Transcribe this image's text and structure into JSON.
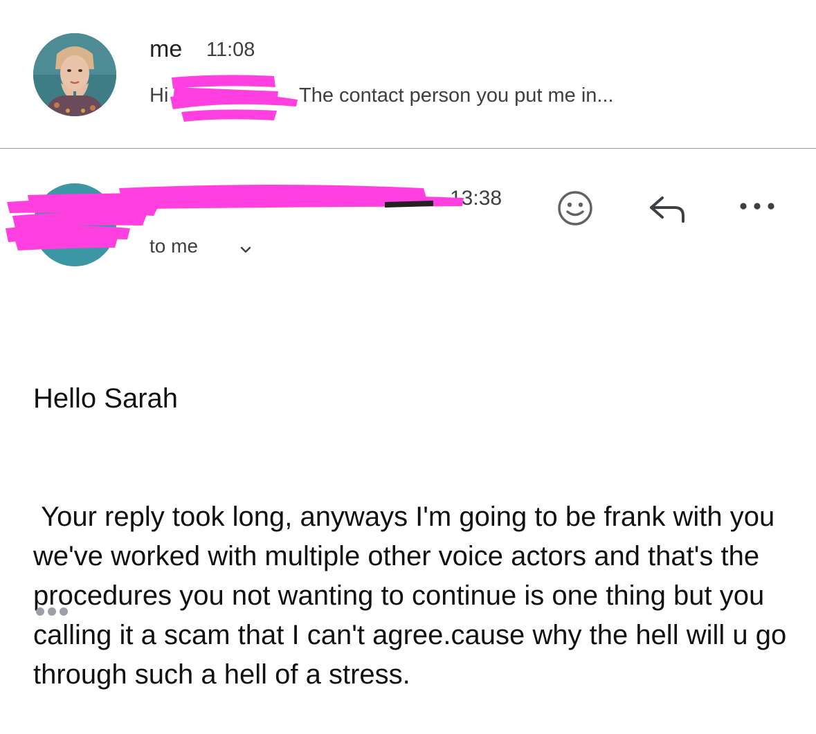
{
  "previous_message": {
    "sender": "me",
    "time": "11:08",
    "snippet_greeting": "Hi",
    "snippet": "The contact person you put me in..."
  },
  "message": {
    "time": "13:38",
    "recipient_label": "to me",
    "greeting": "Hello Sarah",
    "body": " Your reply took long, anyways I'm going to be frank with you we've worked with multiple other voice actors and that's the procedures you not wanting to continue is one thing but you calling it a scam that I can't agree.cause why the hell will u go through such a hell of a stress."
  },
  "icons": {
    "recipient_expand": "chevron-down-icon",
    "react": "smiley-face-icon",
    "reply": "reply-arrow-icon",
    "more": "more-horizontal-icon",
    "trimmed": "show-trimmed-content-icon"
  },
  "colors": {
    "redaction": "#ff3fe0",
    "avatar_teal": "#3b97a4",
    "icon_gray": "#5f6368"
  }
}
